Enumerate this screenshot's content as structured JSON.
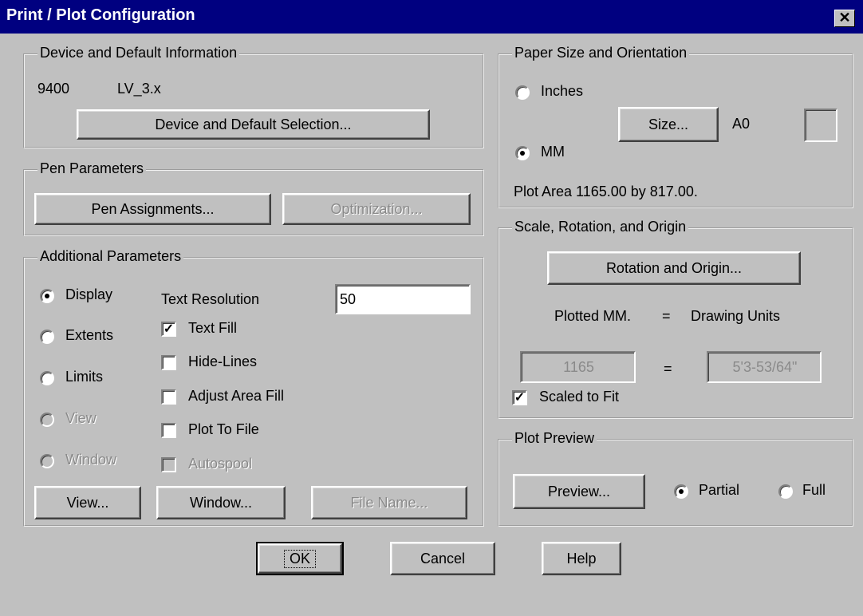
{
  "title": "Print / Plot Configuration",
  "close_glyph": "✕",
  "device": {
    "legend": "Device and Default Information",
    "device_name": "9400",
    "driver": "LV_3.x",
    "button": "Device and Default Selection..."
  },
  "pen": {
    "legend": "Pen Parameters",
    "assign_button": "Pen Assignments...",
    "optimize_button": "Optimization..."
  },
  "additional": {
    "legend": "Additional Parameters",
    "radios": [
      {
        "label": "Display",
        "checked": true,
        "enabled": true
      },
      {
        "label": "Extents",
        "checked": false,
        "enabled": true
      },
      {
        "label": "Limits",
        "checked": false,
        "enabled": true
      },
      {
        "label": "View",
        "checked": false,
        "enabled": false
      },
      {
        "label": "Window",
        "checked": false,
        "enabled": false
      }
    ],
    "text_resolution_label": "Text Resolution",
    "text_resolution_value": "50",
    "checks": [
      {
        "label": "Text Fill",
        "checked": true,
        "enabled": true
      },
      {
        "label": "Hide-Lines",
        "checked": false,
        "enabled": true
      },
      {
        "label": "Adjust Area Fill",
        "checked": false,
        "enabled": true
      },
      {
        "label": "Plot To File",
        "checked": false,
        "enabled": true
      },
      {
        "label": "Autospool",
        "checked": false,
        "enabled": false
      }
    ],
    "view_button": "View...",
    "window_button": "Window...",
    "filename_button": "File Name..."
  },
  "paper": {
    "legend": "Paper Size and Orientation",
    "inches_label": "Inches",
    "inches_checked": false,
    "mm_label": "MM",
    "mm_checked": true,
    "size_button": "Size...",
    "size_value": "A0",
    "plot_area": "Plot Area 1165.00 by 817.00."
  },
  "scale": {
    "legend": "Scale, Rotation, and Origin",
    "rotation_button": "Rotation and Origin...",
    "plotted_label": "Plotted MM.",
    "equals": "=",
    "drawing_units_label": "Drawing Units",
    "plotted_value": "1165",
    "drawing_value": "5'3-53/64\"",
    "scaled_to_fit_label": "Scaled to Fit",
    "scaled_to_fit_checked": true
  },
  "preview": {
    "legend": "Plot Preview",
    "button": "Preview...",
    "partial_label": "Partial",
    "partial_checked": true,
    "full_label": "Full",
    "full_checked": false
  },
  "footer": {
    "ok": "OK",
    "cancel": "Cancel",
    "help": "Help"
  }
}
